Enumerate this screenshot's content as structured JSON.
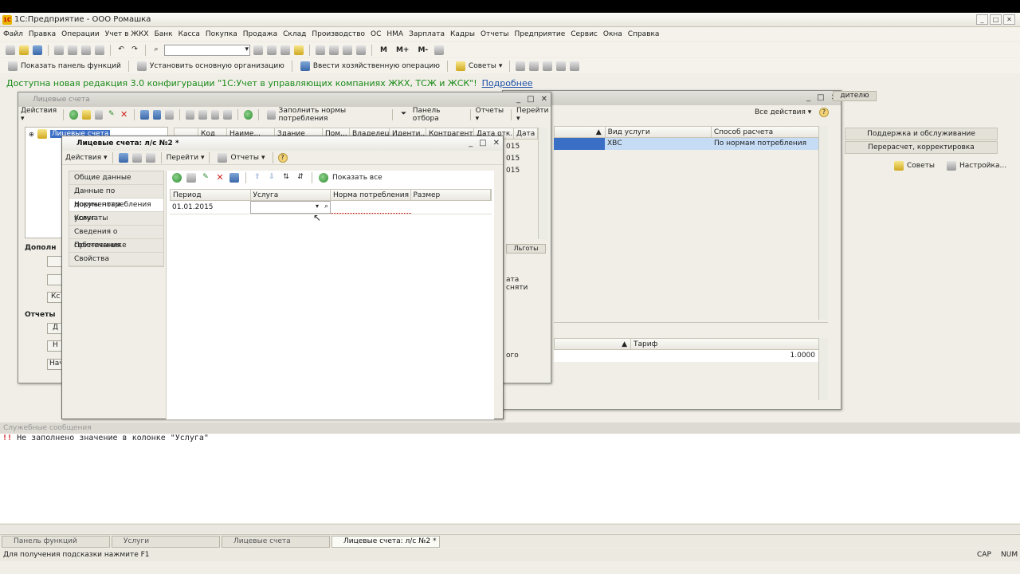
{
  "app_title": "1С:Предприятие - ООО Ромашка",
  "app_logo": "1С",
  "window_controls": [
    "_",
    "□",
    "✕"
  ],
  "menu": [
    "Файл",
    "Правка",
    "Операции",
    "Учет в ЖКХ",
    "Банк",
    "Касса",
    "Покупка",
    "Продажа",
    "Склад",
    "Производство",
    "ОС",
    "НМА",
    "Зарплата",
    "Кадры",
    "Отчеты",
    "Предприятие",
    "Сервис",
    "Окна",
    "Справка"
  ],
  "toolbar2": {
    "show_panel": "Показать панель функций",
    "set_org": "Установить основную организацию",
    "enter_op": "Ввести хозяйственную операцию",
    "tips": "Советы",
    "m": "M",
    "mplus": "M+",
    "mminus": "M-"
  },
  "notice": {
    "text": "Доступна новая редакция 3.0 конфигурации \"1С:Учет в управляющих компаниях ЖКХ, ТСЖ и ЖСК\"!",
    "link": "Подробнее"
  },
  "back_window": {
    "all_actions": "Все действия",
    "tab_top": "дителю",
    "cols": [
      "Вид услуги",
      "Способ расчета"
    ],
    "row": {
      "service": "ХВС",
      "method": "По нормам потребления"
    },
    "side_tabs": [
      "Поддержка и обслуживание",
      "Перерасчет, корректировка"
    ],
    "tips": "Советы",
    "settings": "Настройка...",
    "tariff_col": "Тариф",
    "tariff_value": "1.0000"
  },
  "accounts_window": {
    "title": "Лицевые счета",
    "actions": "Действия",
    "fill_norms": "Заполнить нормы потребления",
    "filter_panel": "Панель отбора",
    "reports": "Отчеты",
    "goto": "Перейти",
    "tree_root": "Лицевые счета",
    "cols": [
      "Код",
      "Наиме...",
      "Здание",
      "Пом...",
      "Владелец",
      "Иденти...",
      "Контрагент",
      "Дата отк...",
      "Дата"
    ],
    "dates": [
      "015",
      "015",
      "015"
    ],
    "group_add": "Дополн",
    "group_reports": "Отчеты",
    "side_btn": "Кс",
    "side_btn2": "Д",
    "side_btn3": "Н",
    "side_btn4": "Нач",
    "mini_tab": "Льготы",
    "mini_col": "ата сняти",
    "mini_col2": "ого"
  },
  "form": {
    "title": "Лицевые счета: л/с №2 *",
    "actions": "Действия",
    "goto": "Перейти",
    "reports": "Отчеты",
    "help": "?",
    "tabs": [
      "Общие данные",
      "Данные по документам",
      "Нормы потребления услуг",
      "Комнаты",
      "Сведения о собственнике",
      "Примечания",
      "Свойства"
    ],
    "show_all": "Показать все",
    "cols": [
      "Период",
      "Услуга",
      "Норма потребления",
      "Размер"
    ],
    "row": {
      "period": "01.01.2015",
      "service": "",
      "norm": "",
      "size": ""
    }
  },
  "service_messages": {
    "title": "Служебные сообщения",
    "marker": "!!",
    "line": "Не заполнено значение в колонке \"Услуга\""
  },
  "taskbar": [
    "Панель функций",
    "Услуги",
    "Лицевые счета",
    "Лицевые счета: л/с №2 *"
  ],
  "status": {
    "hint": "Для получения подсказки нажмите F1",
    "cap": "CAP",
    "num": "NUM"
  }
}
